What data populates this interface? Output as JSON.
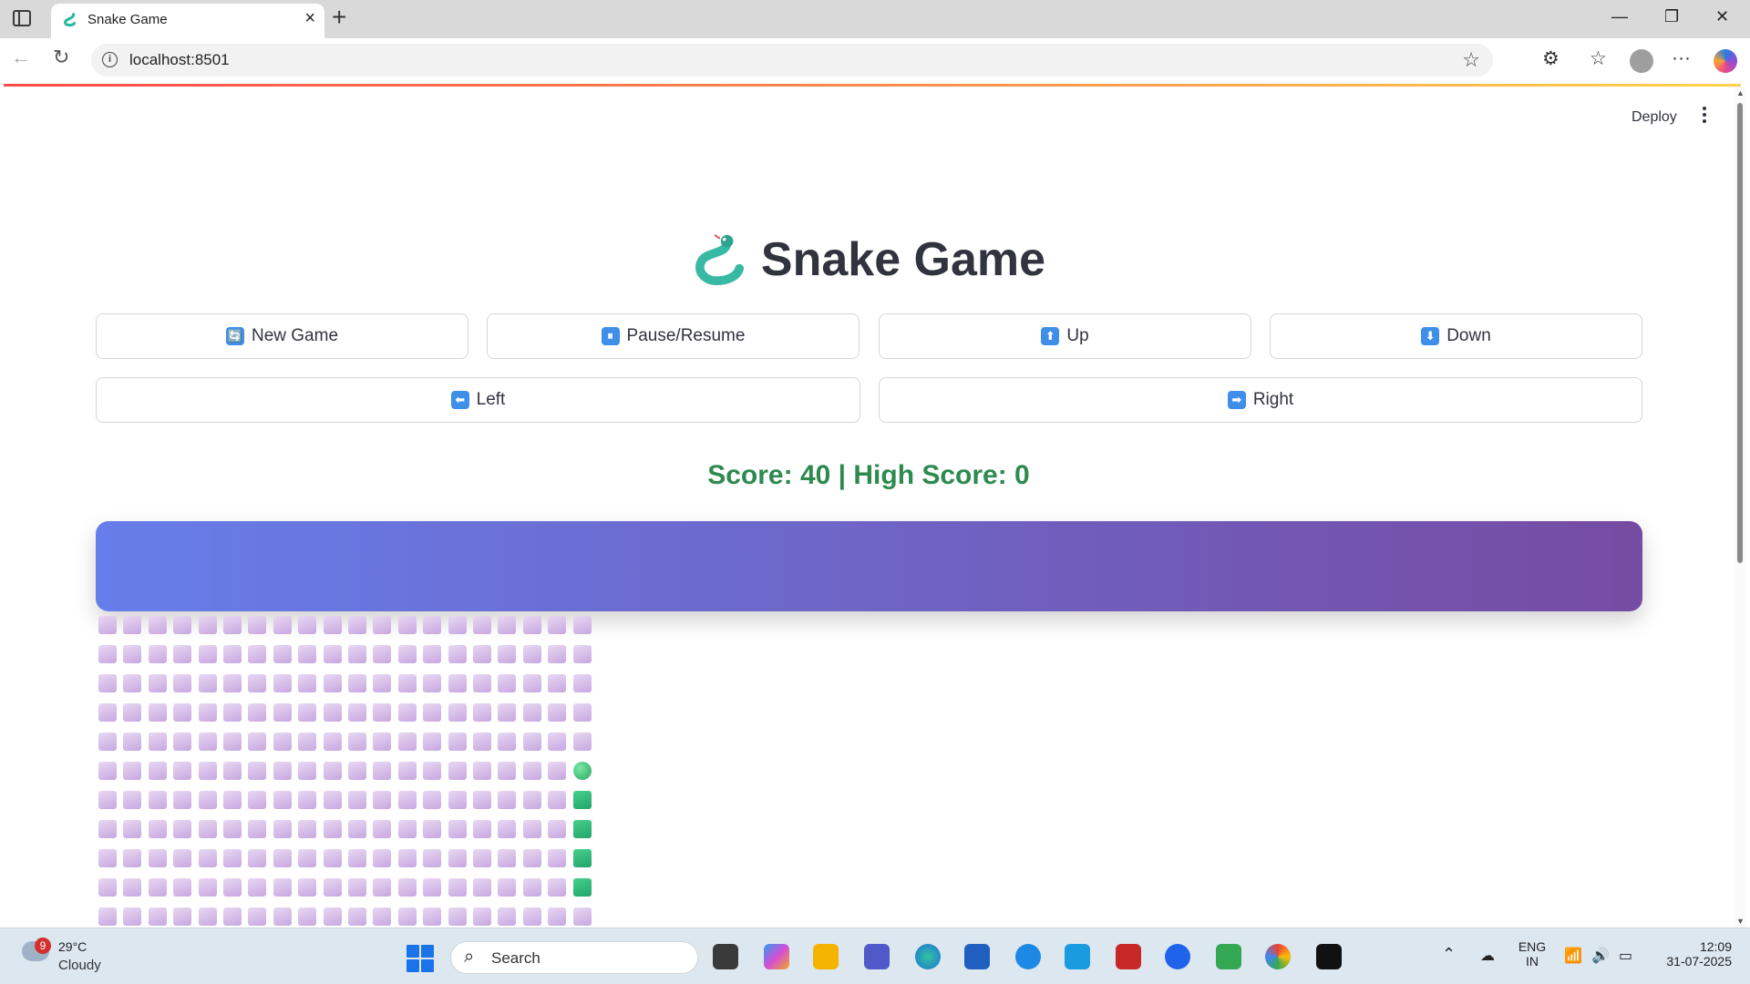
{
  "browser": {
    "tab_title": "Snake Game",
    "url": "localhost:8501"
  },
  "page": {
    "deploy_label": "Deploy",
    "title": "Snake Game",
    "buttons": {
      "new_game": {
        "emoji": "🔄",
        "label": "New Game"
      },
      "pause": {
        "emoji": "⏸",
        "label": "Pause/Resume"
      },
      "up": {
        "emoji": "⬆",
        "label": "Up"
      },
      "down": {
        "emoji": "⬇",
        "label": "Down"
      },
      "left": {
        "emoji": "⬅",
        "label": "Left"
      },
      "right": {
        "emoji": "➡",
        "label": "Right"
      }
    },
    "score_text": "Score: 40 | High Score: 0",
    "board": {
      "columns": 20,
      "visible_rows": 11,
      "snake_head": {
        "row": 5,
        "col": 19
      },
      "snake_body": [
        {
          "row": 6,
          "col": 19
        },
        {
          "row": 7,
          "col": 19
        },
        {
          "row": 8,
          "col": 19
        },
        {
          "row": 9,
          "col": 19
        }
      ],
      "colors": {
        "empty": "#d9bfe9",
        "snake": "#2fb873",
        "banner_start": "#667eea",
        "banner_end": "#764ba2"
      }
    }
  },
  "taskbar": {
    "weather": {
      "badge": "9",
      "temp": "29°C",
      "desc": "Cloudy"
    },
    "search_placeholder": "Search",
    "lang_top": "ENG",
    "lang_bottom": "IN",
    "time": "12:09",
    "date": "31-07-2025"
  }
}
